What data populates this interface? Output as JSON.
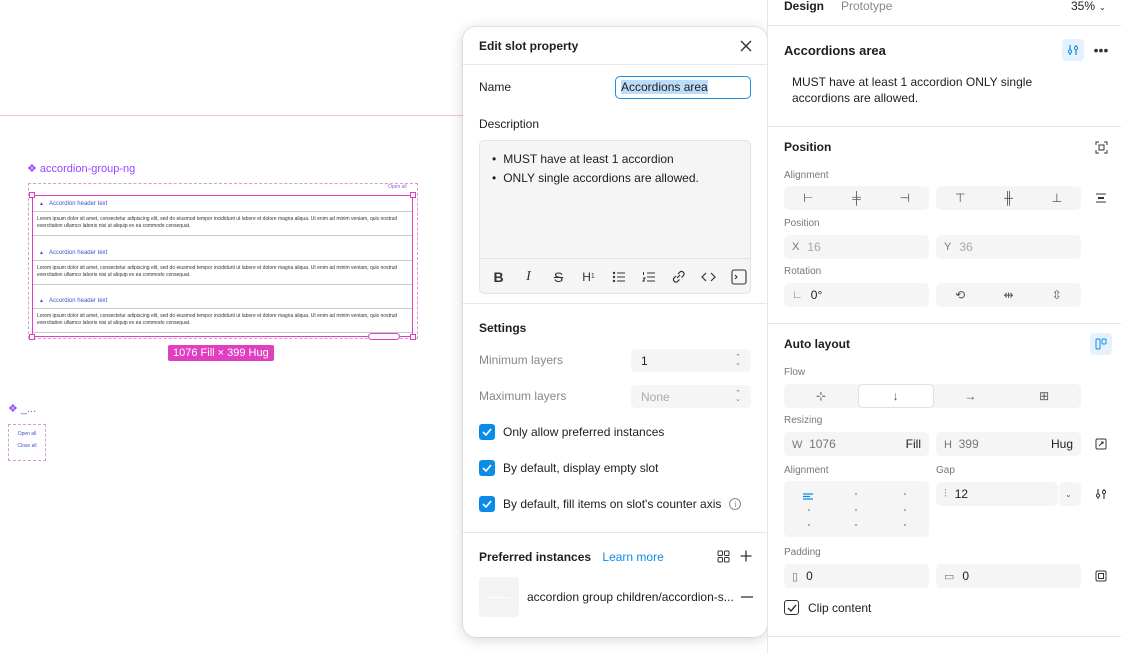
{
  "canvas": {
    "component_label": "accordion-group-ng",
    "component_label_2": "_...",
    "open_all_small": "Open all",
    "accordions": [
      {
        "header": "Accordion header text",
        "body": "Lorem ipsum dolor sit amet, consectetur adipiscing elit, sed do eiusmod tempor incididunt ut labore et dolore magna aliqua. Ut enim ad minim veniam, quis nostrud exercitation ullamco laboris nisi ut aliquip ex ea commodo consequat."
      },
      {
        "header": "Accordion header text",
        "body": "Lorem ipsum dolor sit amet, consectetur adipiscing elit, sed do eiusmod tempor incididunt ut labore et dolore magna aliqua. Ut enim ad minim veniam, quis nostrud exercitation ullamco laboris nisi ut aliquip ex ea commodo consequat."
      },
      {
        "header": "Accordion header text",
        "body": "Lorem ipsum dolor sit amet, consectetur adipiscing elit, sed do eiusmod tempor incididunt ut labore et dolore magna aliqua. Ut enim ad minim veniam, quis nostrud exercitation ullamco laboris nisi ut aliquip ex ea commodo consequat."
      }
    ],
    "dimension_badge": "1076 Fill × 399 Hug",
    "small_frame": {
      "open_all": "Open all",
      "close_all": "Close all"
    },
    "colors": {
      "component": "#9747ff",
      "selection": "#e040c0"
    }
  },
  "dialog": {
    "title": "Edit slot property",
    "name_label": "Name",
    "name_value": "Accordions area",
    "description_label": "Description",
    "description_items": [
      "MUST have at least 1 accordion",
      "ONLY single accordions are allowed."
    ],
    "settings_title": "Settings",
    "min_layers_label": "Minimum layers",
    "min_layers_value": "1",
    "max_layers_label": "Maximum layers",
    "max_layers_placeholder": "None",
    "checkboxes": [
      {
        "label": "Only allow preferred instances",
        "checked": true
      },
      {
        "label": "By default, display empty slot",
        "checked": true
      },
      {
        "label": "By default, fill items on slot's counter axis",
        "checked": true
      }
    ],
    "preferred_title": "Preferred instances",
    "learn_more": "Learn more",
    "preferred_item": "accordion group children/accordion-s...",
    "accent": "#0c8ce9"
  },
  "panel": {
    "tabs": {
      "design": "Design",
      "prototype": "Prototype"
    },
    "zoom": "35%",
    "layer_title": "Accordions area",
    "layer_description": "MUST have at least 1 accordion ONLY single accordions are allowed.",
    "position": {
      "title": "Position",
      "alignment_label": "Alignment",
      "position_label": "Position",
      "x_label": "X",
      "x_value": "16",
      "y_label": "Y",
      "y_value": "36",
      "rotation_label": "Rotation",
      "rotation_value": "0°"
    },
    "auto_layout": {
      "title": "Auto layout",
      "flow_label": "Flow",
      "resizing_label": "Resizing",
      "w_label": "W",
      "w_value": "1076",
      "w_mode": "Fill",
      "h_label": "H",
      "h_value": "399",
      "h_mode": "Hug",
      "alignment_label": "Alignment",
      "gap_label": "Gap",
      "gap_value": "12",
      "padding_label": "Padding",
      "padding_h": "0",
      "padding_v": "0",
      "clip_content": "Clip content"
    }
  }
}
